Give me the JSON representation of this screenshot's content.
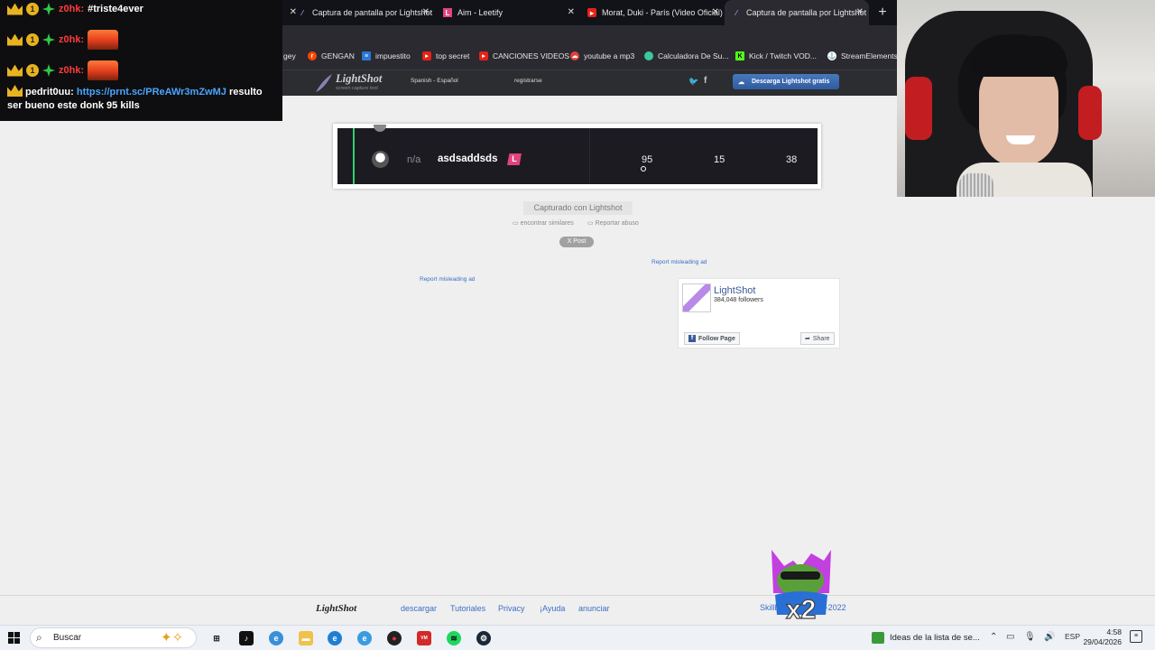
{
  "browser": {
    "tabs": [
      {
        "label": "",
        "active": false
      },
      {
        "label": "Captura de pantalla por Lightshot",
        "active": false
      },
      {
        "label": "Aim - Leetify",
        "active": false
      },
      {
        "label": "Morat, Duki - París (Video Oficial)",
        "active": false
      },
      {
        "label": "Captura de pantalla por Lightshot",
        "active": true
      }
    ],
    "new_tab_label": "+",
    "bookmarks": [
      {
        "label": "gey",
        "icon": "bookmark-icon"
      },
      {
        "label": "GENGAN",
        "icon": "reddit-icon"
      },
      {
        "label": "impuestito",
        "icon": "document-icon"
      },
      {
        "label": "top secret",
        "icon": "youtube-icon"
      },
      {
        "label": "CANCIONES VIDEOS",
        "icon": "youtube-icon"
      },
      {
        "label": "youtube a mp3",
        "icon": "cloud-icon"
      },
      {
        "label": "Calculadora De Su...",
        "icon": "calculator-icon"
      },
      {
        "label": "Kick / Twitch VOD...",
        "icon": "kick-icon"
      },
      {
        "label": "StreamElements |",
        "icon": "streamelements-icon"
      }
    ]
  },
  "lightshot_header": {
    "logo": "LightShot",
    "tagline": "screen capture tool",
    "language": "Spanish - Español",
    "register": "registrarse",
    "download_button": "Descarga Lightshot gratis"
  },
  "chat": {
    "messages": [
      {
        "user": "z0hk:",
        "text": "#triste4ever",
        "emote": false
      },
      {
        "user": "z0hk:",
        "text": "",
        "emote": true
      },
      {
        "user": "z0hk:",
        "text": "",
        "emote": true
      }
    ],
    "last": {
      "user": "pedrit0uu:",
      "link": "https://prnt.sc/PReAWr3mZwMJ",
      "text": "resulto ser bueno este donk 95 kills"
    },
    "badge_number": "1"
  },
  "screenshot": {
    "rank": "n/a",
    "player": "asdsaddsds",
    "badge": "L",
    "kills": "95",
    "deaths": "15",
    "assists": "38"
  },
  "page": {
    "captured_label": "Capturado con Lightshot",
    "find_similar": "encontrar similares",
    "report_abuse": "Reportar abuso",
    "post_button": "X Post",
    "report_ad_right": "Report misleading ad",
    "report_ad_left": "Report misleading ad"
  },
  "facebook_widget": {
    "page_name": "LightShot",
    "followers": "384,048 followers",
    "follow_button": "Follow Page",
    "share_button": "Share"
  },
  "footer": {
    "logo": "LightShot",
    "links": [
      "descargar",
      "Tutoriales",
      "Privacy",
      "¡Ayuda",
      "anunciar"
    ],
    "copyright": "Skillbrains © 2009-2022"
  },
  "overlay_emote_text": "x2",
  "taskbar": {
    "search_placeholder": "Buscar",
    "notification_text": "Ideas de la lista de se...",
    "language": "ESP",
    "time": "4:58",
    "date": "29/04/2026"
  },
  "colors": {
    "chat_username": "#ff3b3b",
    "link": "#3b6fc2",
    "card_accent": "#2ed16b",
    "download_button": "#3a68ad"
  }
}
